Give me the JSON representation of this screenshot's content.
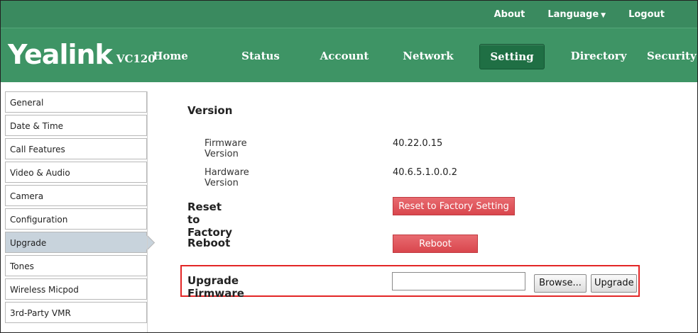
{
  "topbar": {
    "links": [
      {
        "label": "About"
      },
      {
        "label": "Language"
      },
      {
        "label": "Logout"
      }
    ]
  },
  "brand": {
    "name": "Yealink",
    "model": "VC120"
  },
  "nav": {
    "tabs": [
      {
        "label": "Home"
      },
      {
        "label": "Status"
      },
      {
        "label": "Account"
      },
      {
        "label": "Network"
      },
      {
        "label": "Setting"
      },
      {
        "label": "Directory"
      },
      {
        "label": "Security"
      }
    ],
    "active": "Setting"
  },
  "sidebar": {
    "items": [
      {
        "label": "General"
      },
      {
        "label": "Date & Time"
      },
      {
        "label": "Call Features"
      },
      {
        "label": "Video & Audio"
      },
      {
        "label": "Camera"
      },
      {
        "label": "Configuration"
      },
      {
        "label": "Upgrade"
      },
      {
        "label": "Tones"
      },
      {
        "label": "Wireless Micpod"
      },
      {
        "label": "3rd-Party VMR"
      }
    ],
    "active": "Upgrade"
  },
  "main": {
    "version": {
      "title": "Version",
      "firmware_label": "Firmware Version",
      "firmware_value": "40.22.0.15",
      "hardware_label": "Hardware Version",
      "hardware_value": "40.6.5.1.0.0.2"
    },
    "reset": {
      "title": "Reset to Factory",
      "button": "Reset to Factory Setting"
    },
    "reboot": {
      "title": "Reboot",
      "button": "Reboot"
    },
    "upgrade": {
      "title": "Upgrade Firmware",
      "file_value": "",
      "browse_button": "Browse...",
      "upgrade_button": "Upgrade"
    }
  },
  "colors": {
    "header_green": "#3e9465",
    "active_tab": "#1f6f44",
    "button_red": "#e0535a",
    "highlight_red": "#e32626",
    "sidebar_active": "#c8d3dc"
  }
}
